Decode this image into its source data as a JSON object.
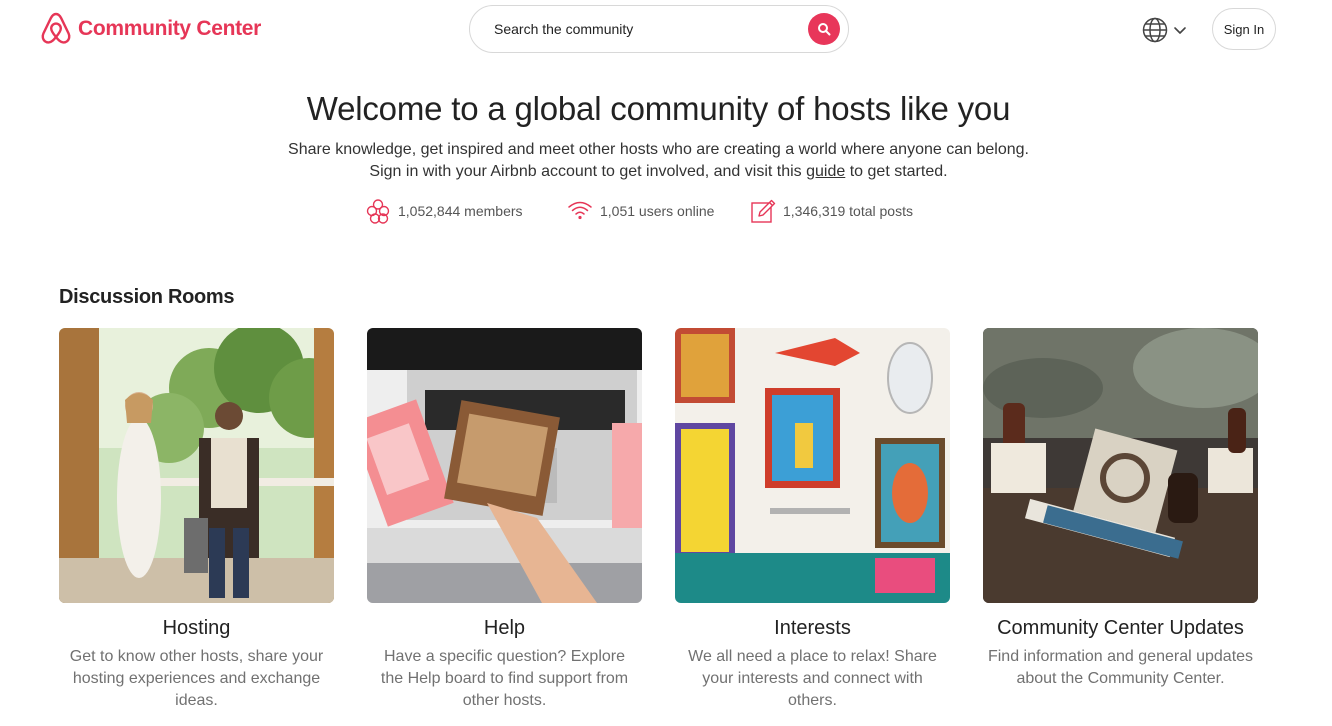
{
  "header": {
    "logo_text": "Community Center",
    "search_placeholder": "Search the community",
    "sign_in_label": "Sign In"
  },
  "hero": {
    "title": "Welcome to a global community of hosts like you",
    "line1": "Share knowledge, get inspired and meet other hosts who are creating a world where anyone can belong.",
    "line2_before": "Sign in with your Airbnb account to get involved, and visit this",
    "line2_link": "guide",
    "line2_after": "to get started."
  },
  "stats": {
    "members": "1,052,844 members",
    "online": "1,051 users online",
    "posts": "1,346,319 total posts"
  },
  "section": {
    "title": "Discussion Rooms"
  },
  "rooms": [
    {
      "title": "Hosting",
      "description": "Get to know other hosts, share your hosting experiences and exchange ideas."
    },
    {
      "title": "Help",
      "description": "Have a specific question? Explore the Help board to find support from other hosts."
    },
    {
      "title": "Interests",
      "description": "We all need a place to relax! Share your interests and connect with others."
    },
    {
      "title": "Community Center Updates",
      "description": "Find information and general updates about the Community Center."
    }
  ],
  "colors": {
    "brand": "#e63657",
    "text": "#222222",
    "muted": "#717171"
  },
  "icons": {
    "logo": "airbnb-belo-icon",
    "search": "search-icon",
    "language": "globe-icon",
    "members": "people-icon",
    "online": "wifi-icon",
    "posts": "edit-icon"
  }
}
